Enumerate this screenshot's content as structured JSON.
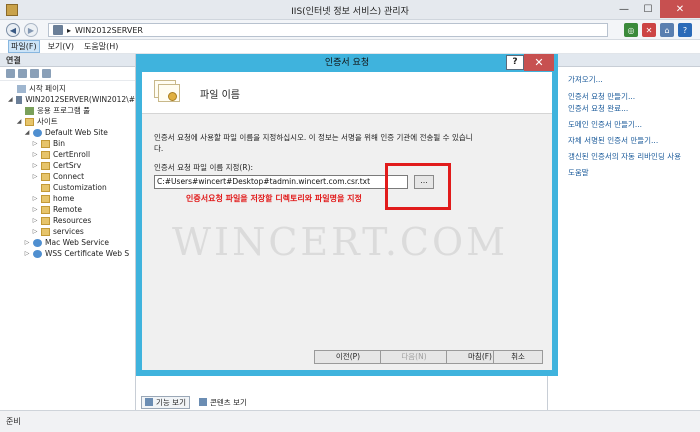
{
  "window": {
    "title": "IIS(인터넷 정보 서비스) 관리자"
  },
  "address": {
    "path": "WIN2012SERVER",
    "separator": "▸"
  },
  "menu": {
    "items": [
      "파일(F)",
      "보기(V)",
      "도움말(H)"
    ]
  },
  "left_panel": {
    "title": "연결",
    "tree": [
      {
        "label": "시작 페이지",
        "indent": 1,
        "icon": "page",
        "expander": ""
      },
      {
        "label": "WIN2012SERVER(WIN2012\\#",
        "indent": 1,
        "icon": "server",
        "expander": "◢"
      },
      {
        "label": "응용 프로그램 풀",
        "indent": 2,
        "icon": "pool",
        "expander": ""
      },
      {
        "label": "사이트",
        "indent": 2,
        "icon": "folder",
        "expander": "◢"
      },
      {
        "label": "Default Web Site",
        "indent": 3,
        "icon": "site",
        "expander": "◢"
      },
      {
        "label": "Bin",
        "indent": 4,
        "icon": "folder",
        "expander": "▷"
      },
      {
        "label": "CertEnroll",
        "indent": 4,
        "icon": "folder",
        "expander": "▷"
      },
      {
        "label": "CertSrv",
        "indent": 4,
        "icon": "folder",
        "expander": "▷"
      },
      {
        "label": "Connect",
        "indent": 4,
        "icon": "folder",
        "expander": "▷"
      },
      {
        "label": "Customization",
        "indent": 4,
        "icon": "folder",
        "expander": ""
      },
      {
        "label": "home",
        "indent": 4,
        "icon": "folder",
        "expander": "▷"
      },
      {
        "label": "Remote",
        "indent": 4,
        "icon": "folder",
        "expander": "▷"
      },
      {
        "label": "Resources",
        "indent": 4,
        "icon": "folder",
        "expander": "▷"
      },
      {
        "label": "services",
        "indent": 4,
        "icon": "folder",
        "expander": "▷"
      },
      {
        "label": "Mac Web Service",
        "indent": 3,
        "icon": "site",
        "expander": "▷"
      },
      {
        "label": "WSS Certificate Web S",
        "indent": 3,
        "icon": "site",
        "expander": "▷"
      }
    ]
  },
  "right_panel": {
    "actions": [
      "가져오기...",
      "인증서 요청 만들기...",
      "인증서 요청 완료...",
      "도메인 인증서 만들기...",
      "자체 서명된 인증서 만들기...",
      "갱신된 인증서의 자동 리바인딩 사용",
      "도움말"
    ]
  },
  "bottom_tabs": {
    "features": "기능 보기",
    "content": "콘텐츠 보기"
  },
  "status": {
    "text": "준비"
  },
  "dialog": {
    "title": "인증서 요청",
    "help": "?",
    "close": "✕",
    "header": "파일 이름",
    "description": "인증서 요청에 사용할 파일 이름을 지정하십시오. 이 정보는 서명을 위해 인증 기관에 전송될 수 있습니다.",
    "field_label": "인증서 요청 파일 이름 지정(R):",
    "field_value": "C:#Users#wincert#Desktop#tadmin.wincert.com.csr.txt",
    "browse_label": "...",
    "annotation": "인증서요청 파일을 저장할 디렉토리와 파일명을 지정",
    "watermark": "WINCERT.COM",
    "buttons": {
      "prev": "이전(P)",
      "next": "다음(N)",
      "finish": "마침(F)",
      "cancel": "취소"
    }
  },
  "colors": {
    "dialog_frame": "#3fb3dd",
    "annotation": "#e11b1b",
    "close": "#c75050"
  }
}
